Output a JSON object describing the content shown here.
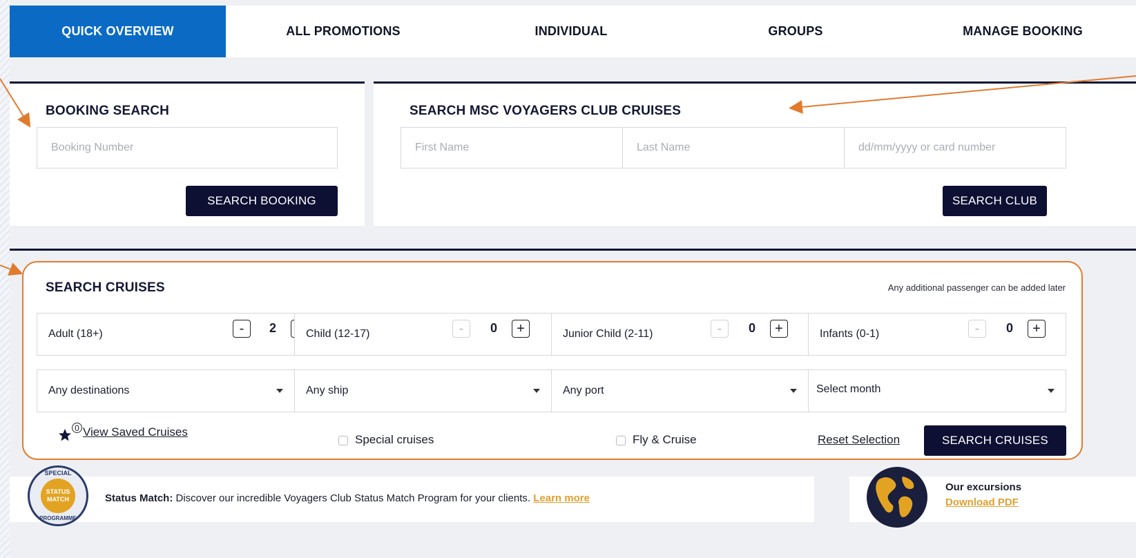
{
  "tabs": [
    {
      "label": "QUICK OVERVIEW",
      "active": true
    },
    {
      "label": "ALL PROMOTIONS",
      "active": false
    },
    {
      "label": "INDIVIDUAL",
      "active": false
    },
    {
      "label": "GROUPS",
      "active": false
    },
    {
      "label": "MANAGE BOOKING",
      "active": false
    }
  ],
  "booking_search": {
    "title": "BOOKING SEARCH",
    "placeholder": "Booking Number",
    "button": "SEARCH BOOKING"
  },
  "club_search": {
    "title": "SEARCH MSC VOYAGERS CLUB CRUISES",
    "first_name_placeholder": "First Name",
    "last_name_placeholder": "Last Name",
    "card_placeholder": "dd/mm/yyyy or card number",
    "button": "SEARCH CLUB"
  },
  "cruise_search": {
    "title": "SEARCH CRUISES",
    "note": "Any additional passenger can be added later",
    "passengers": [
      {
        "label": "Adult (18+)",
        "count": "2",
        "minus_enabled": true
      },
      {
        "label": "Child (12-17)",
        "count": "0",
        "minus_enabled": false
      },
      {
        "label": "Junior Child (2-11)",
        "count": "0",
        "minus_enabled": false
      },
      {
        "label": "Infants (0-1)",
        "count": "0",
        "minus_enabled": false
      }
    ],
    "minus": "-",
    "plus": "+",
    "selects": [
      {
        "value": "Any destinations"
      },
      {
        "value": "Any ship"
      },
      {
        "value": "Any port"
      },
      {
        "value": "Select month"
      }
    ],
    "saved_count": "0",
    "saved_label": "View Saved Cruises",
    "special_label": "Special cruises",
    "fly_label": "Fly & Cruise",
    "reset_label": "Reset Selection",
    "button": "SEARCH CRUISES"
  },
  "status_match": {
    "badge_top": "SPECIAL",
    "badge_mid1": "STATUS",
    "badge_mid2": "MATCH",
    "badge_bottom": "PROGRAMME",
    "bold": "Status Match:",
    "text": " Discover our incredible Voyagers Club Status Match Program for your clients. ",
    "link": "Learn more"
  },
  "excursions": {
    "title": "Our excursions",
    "link": "Download PDF"
  },
  "colors": {
    "accent_blue": "#0b6bc4",
    "navy": "#0d0f33",
    "orange": "#e07b2e",
    "link_orange": "#e0a030"
  }
}
